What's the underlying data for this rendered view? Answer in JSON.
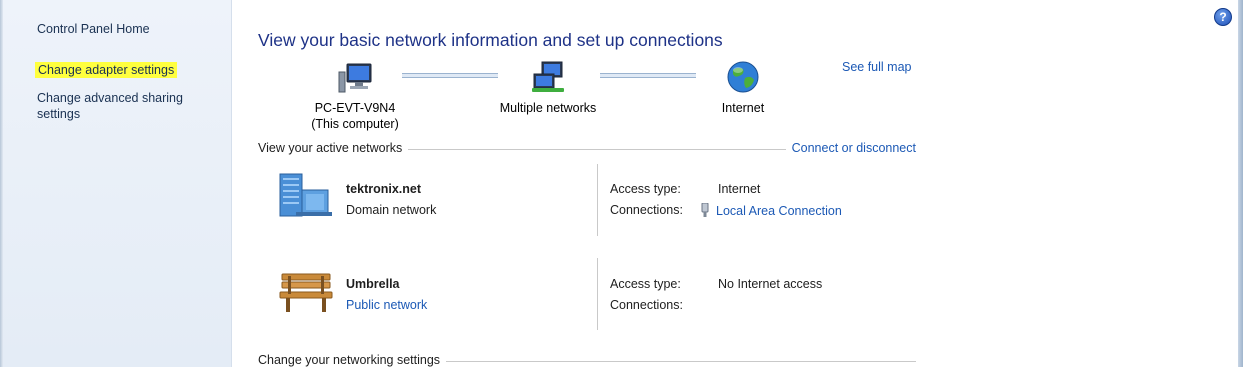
{
  "sidebar": {
    "items": [
      {
        "label": "Control Panel Home"
      },
      {
        "label": "Change adapter settings"
      },
      {
        "label": "Change advanced sharing settings"
      }
    ]
  },
  "help": {
    "glyph": "?"
  },
  "header": {
    "title": "View your basic network information and set up connections"
  },
  "network_map": {
    "computer": {
      "name": "PC-EVT-V9N4",
      "sub": "(This computer)"
    },
    "middle": {
      "name": "Multiple networks"
    },
    "internet": {
      "name": "Internet"
    },
    "see_full_map": "See full map"
  },
  "active_networks": {
    "heading": "View your active networks",
    "connect_link": "Connect or disconnect",
    "networks": [
      {
        "name": "tektronix.net",
        "type": "Domain network",
        "icon": "domain-building-icon",
        "access_key": "Access type:",
        "access_value": "Internet",
        "connections_key": "Connections:",
        "connection_link": "Local Area Connection"
      },
      {
        "name": "Umbrella",
        "type": "Public network",
        "icon": "park-bench-icon",
        "access_key": "Access type:",
        "access_value": "No Internet access",
        "connections_key": "Connections:",
        "connection_link": ""
      }
    ]
  },
  "settings_section": {
    "heading": "Change your networking settings"
  },
  "colors": {
    "link": "#1c59b5",
    "title": "#1e3287",
    "highlight": "#ffff3e"
  }
}
